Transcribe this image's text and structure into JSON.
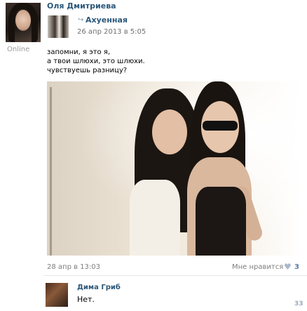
{
  "post": {
    "author_name": "Оля Дмитриева",
    "status": "Online",
    "source": {
      "repost_icon": "repost-arrow-icon",
      "name": "Ахуенная",
      "date": "26 апр 2013 в 5:05"
    },
    "text_lines": [
      "запомни, я это я,",
      "а твои шлюхи, это шлюхи.",
      "чувствуешь разницу?"
    ],
    "date": "28 апр в 13:03",
    "like_label": "Мне нравится",
    "like_icon": "heart-icon",
    "like_count": "3"
  },
  "comment": {
    "author_name": "Дима Гриб",
    "text": "Нет.",
    "count": "33"
  },
  "colors": {
    "link": "#2b587a",
    "muted": "#7e7e7e",
    "like_count": "#5b7fa6"
  }
}
